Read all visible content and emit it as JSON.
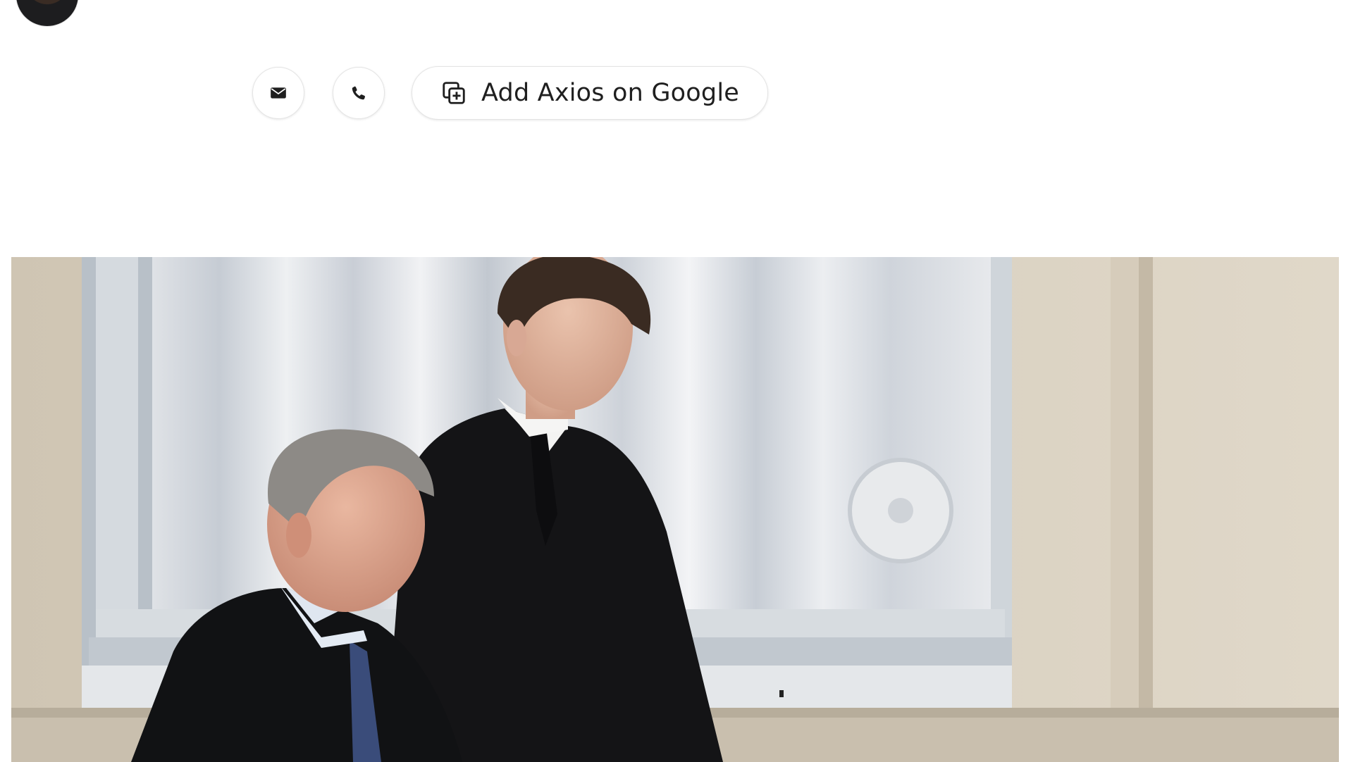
{
  "author": {
    "avatar_icon": "author-avatar"
  },
  "actions": {
    "email_icon": "mail-icon",
    "phone_icon": "phone-icon",
    "google_icon": "add-source-icon",
    "google_label": "Add Axios on Google"
  },
  "hero": {
    "image_icon": "hero-photo"
  },
  "colors": {
    "button_border": "#e4e4e4",
    "text": "#1f1f1f",
    "icon": "#1f1f1f"
  }
}
